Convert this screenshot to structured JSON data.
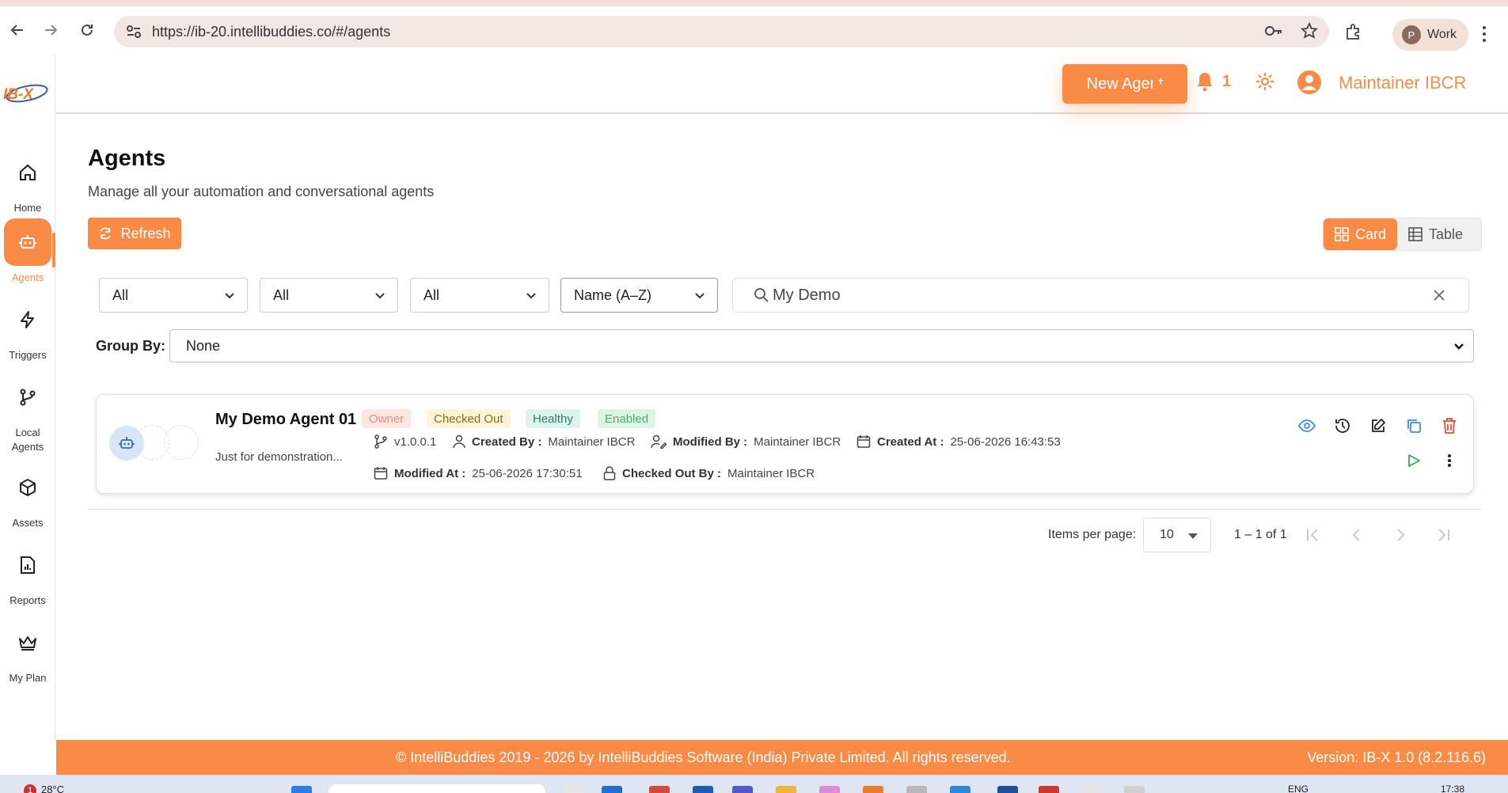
{
  "browser": {
    "url": "https://ib-20.intellibuddies.co/#/agents",
    "profile_initial": "P",
    "profile_label": "Work"
  },
  "logo_text": "IB-X",
  "sidebar": {
    "items": [
      {
        "label": "Home",
        "icon": "home-icon"
      },
      {
        "label": "Agents",
        "icon": "robot-icon",
        "active": true
      },
      {
        "label": "Triggers",
        "icon": "lightning-icon"
      },
      {
        "label": "Local Agents",
        "icon": "branch-icon"
      },
      {
        "label": "Assets",
        "icon": "cube-icon"
      },
      {
        "label": "Reports",
        "icon": "report-icon"
      },
      {
        "label": "My Plan",
        "icon": "crown-icon"
      }
    ]
  },
  "header": {
    "new_agent_label": "New Agent",
    "notification_count": "1",
    "user_name": "Maintainer IBCR"
  },
  "page": {
    "title": "Agents",
    "subtitle": "Manage all your automation and conversational agents",
    "refresh_label": "Refresh",
    "view_card_label": "Card",
    "view_table_label": "Table",
    "active_view": "Card"
  },
  "filters": {
    "filter1": "All",
    "filter2": "All",
    "filter3": "All",
    "sort": "Name (A–Z)",
    "search_value": "My Demo",
    "group_by_label": "Group By:",
    "group_by_value": "None"
  },
  "agent": {
    "name": "My Demo Agent 01",
    "badges": [
      "Owner",
      "Checked Out",
      "Healthy",
      "Enabled"
    ],
    "description": "Just for demonstration...",
    "version": "v1.0.0.1",
    "created_by_label": "Created By :",
    "created_by": "Maintainer IBCR",
    "modified_by_label": "Modified By :",
    "modified_by": "Maintainer IBCR",
    "created_at_label": "Created At :",
    "created_at": "25-06-2026 16:43:53",
    "modified_at_label": "Modified At :",
    "modified_at": "25-06-2026 17:30:51",
    "checked_out_by_label": "Checked Out By :",
    "checked_out_by": "Maintainer IBCR"
  },
  "paginator": {
    "items_per_page_label": "Items per page:",
    "items_per_page": "10",
    "range": "1 – 1 of 1"
  },
  "footer": {
    "copyright": "© IntelliBuddies 2019 - 2026 by IntelliBuddies Software (India) Private Limited. All rights reserved.",
    "version": "Version: IB-X 1.0 (8.2.116.6)"
  },
  "taskbar": {
    "weather_alert": "1",
    "temperature": "28°C",
    "language": "ENG",
    "time": "17:38"
  },
  "colors": {
    "accent": "#f98b47",
    "owner_badge": "#fde7e2",
    "checked_badge": "#fdf3d6",
    "healthy_badge": "#dff3ee",
    "enabled_badge": "#ddf3e4"
  }
}
